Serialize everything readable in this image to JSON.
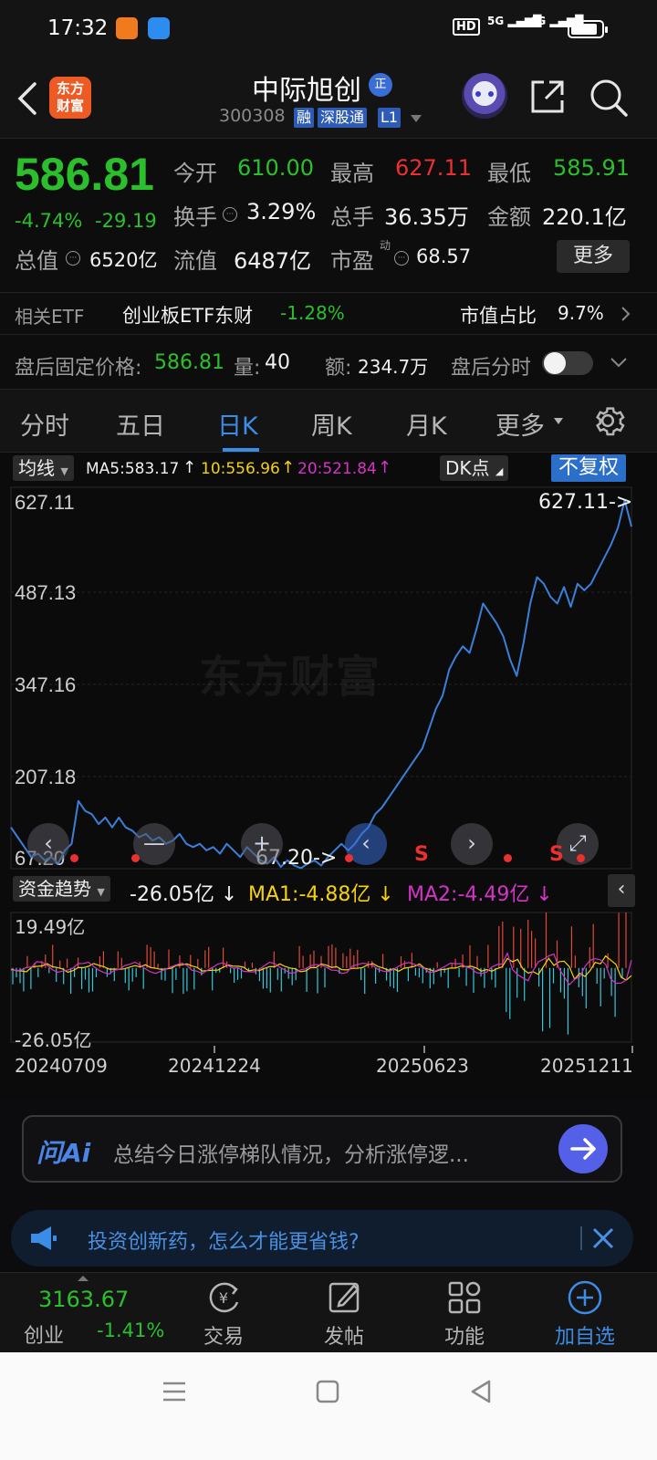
{
  "status_bar": {
    "time": "17:32",
    "signal_labels": [
      "HD",
      "5G",
      "4G"
    ]
  },
  "header": {
    "back_icon": "chevron-left-icon",
    "logo_text_line1": "东方",
    "logo_text_line2": "财富",
    "stock_name": "中际旭创",
    "zheng_badge": "正",
    "stock_code": "300308",
    "tags": [
      "融",
      "深股通",
      "L1"
    ]
  },
  "quote": {
    "price": "586.81",
    "change_pct": "-4.74%",
    "change_abs": "-29.19",
    "open_label": "今开",
    "open": "610.00",
    "high_label": "最高",
    "high": "627.11",
    "low_label": "最低",
    "low": "585.91",
    "turnover_label": "换手",
    "turnover": "3.29%",
    "volume_label": "总手",
    "volume": "36.35万",
    "amount_label": "金额",
    "amount": "220.1亿",
    "mktcap_label": "总值",
    "mktcap": "6520亿",
    "float_label": "流值",
    "float": "6487亿",
    "pe_label": "市盈",
    "pe_sup": "动",
    "pe": "68.57",
    "more_button": "更多"
  },
  "etf": {
    "label": "相关ETF",
    "name": "创业板ETF东财",
    "change": "-1.28%",
    "ratio_label": "市值占比",
    "ratio": "9.7%"
  },
  "after_hours": {
    "price_label": "盘后固定价格:",
    "price": "586.81",
    "vol_label": "量:",
    "vol": "40",
    "amt_label": "额:",
    "amt": "234.7万",
    "timeshare_label": "盘后分时"
  },
  "tabs": [
    {
      "label": "分时",
      "active": false
    },
    {
      "label": "五日",
      "active": false
    },
    {
      "label": "日K",
      "active": true
    },
    {
      "label": "周K",
      "active": false
    },
    {
      "label": "月K",
      "active": false
    },
    {
      "label": "更多",
      "active": false
    }
  ],
  "chart": {
    "ma_selector": "均线",
    "ma5": "MA5:583.17",
    "ma10": "10:556.96",
    "ma20": "20:521.84",
    "dk_button": "DK点",
    "adjust_button": "不复权",
    "y_ticks": [
      "627.11",
      "487.13",
      "347.16",
      "207.18",
      "67.20"
    ],
    "max_marker": "627.11->",
    "min_marker": "67.20->",
    "watermark": "东方财富",
    "sell_marks": [
      "S",
      "S"
    ]
  },
  "fund_flow": {
    "selector": "资金趋势",
    "value": "-26.05亿",
    "ma1": "MA1:-4.88亿",
    "ma2": "MA2:-4.49亿",
    "y_top": "19.49亿",
    "y_bottom": "-26.05亿",
    "dates": [
      "20240709",
      "20241224",
      "20250623",
      "20251211"
    ]
  },
  "chart_data": {
    "type": "line",
    "title": "",
    "ylim": [
      67.2,
      627.11
    ],
    "y_ticks": [
      627.11,
      487.13,
      347.16,
      207.18,
      67.2
    ],
    "x_ticks": [
      "20240709",
      "20241224",
      "20250623",
      "20251211"
    ],
    "series": [
      {
        "values": [
          130,
          115,
          100,
          85,
          90,
          80,
          85,
          75,
          95,
          105,
          170,
          155,
          150,
          135,
          145,
          130,
          145,
          130,
          125,
          115,
          120,
          110,
          115,
          105,
          110,
          120,
          105,
          100,
          105,
          95,
          100,
          90,
          105,
          95,
          85,
          100,
          90,
          80,
          75,
          85,
          70,
          80,
          72,
          68,
          75,
          80,
          72,
          85,
          95,
          105,
          95,
          105,
          120,
          130,
          150,
          160,
          175,
          190,
          205,
          220,
          235,
          250,
          280,
          310,
          330,
          370,
          390,
          405,
          395,
          430,
          470,
          455,
          440,
          420,
          385,
          360,
          410,
          470,
          510,
          500,
          480,
          470,
          495,
          465,
          500,
          490,
          500,
          520,
          540,
          560,
          585,
          627.11,
          586.81
        ]
      }
    ],
    "fund_flow_ylim": [
      -26.05,
      19.49
    ]
  },
  "ask_ai": {
    "brand": "问Ai",
    "placeholder": "总结今日涨停梯队情况，分析涨停逻..."
  },
  "banner": {
    "text": "投资创新药，怎么才能更省钱?"
  },
  "bottom_nav": {
    "index_value": "3163.67",
    "index_name": "创业",
    "index_change": "-1.41%",
    "items": [
      "交易",
      "发帖",
      "功能",
      "加自选"
    ]
  },
  "colors": {
    "up": "#ec2f2f",
    "down": "#2bc02b",
    "accent": "#3b8ce6",
    "line": "#3a7fd9"
  }
}
